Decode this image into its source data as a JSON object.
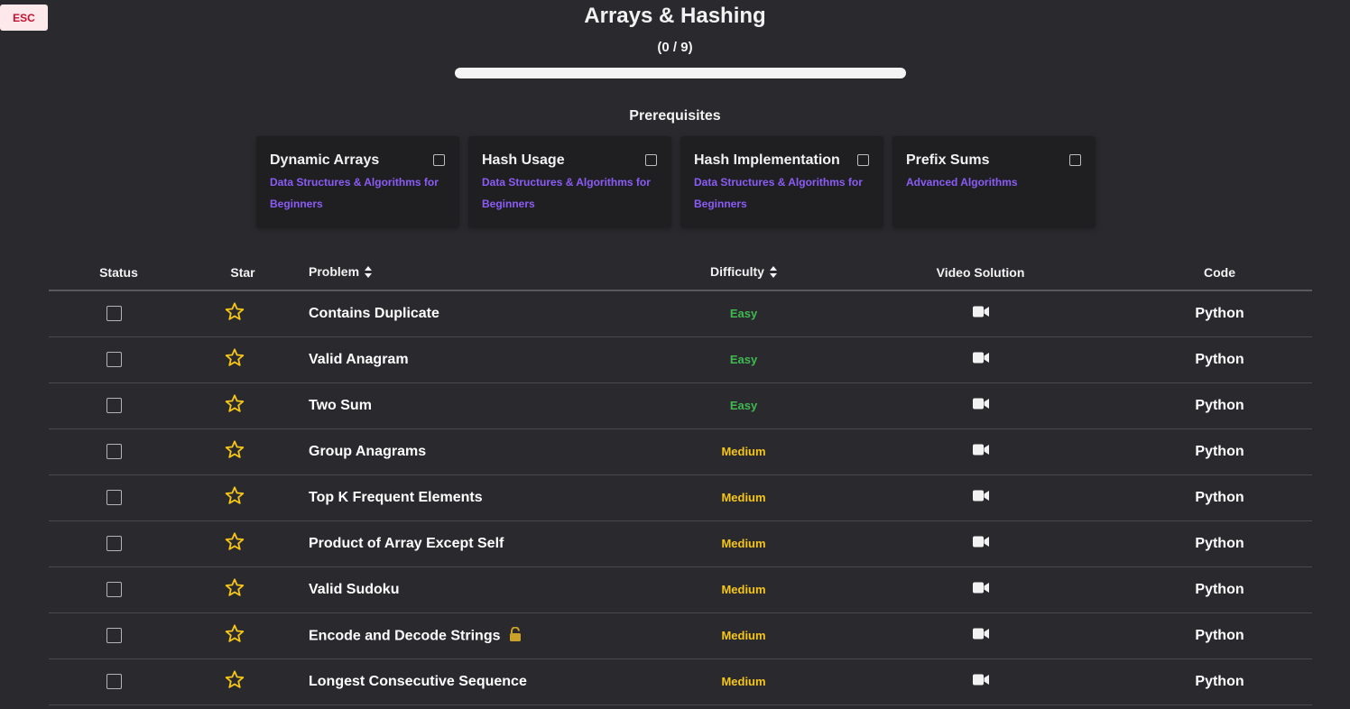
{
  "esc_label": "ESC",
  "title": "Arrays & Hashing",
  "progress": {
    "text": "(0 / 9)",
    "completed": 0,
    "total": 9
  },
  "prerequisites": {
    "heading": "Prerequisites",
    "items": [
      {
        "name": "Dynamic Arrays",
        "course": "Data Structures & Algorithms for Beginners"
      },
      {
        "name": "Hash Usage",
        "course": "Data Structures & Algorithms for Beginners"
      },
      {
        "name": "Hash Implementation",
        "course": "Data Structures & Algorithms for Beginners"
      },
      {
        "name": "Prefix Sums",
        "course": "Advanced Algorithms"
      }
    ]
  },
  "table": {
    "headers": {
      "status": "Status",
      "star": "Star",
      "problem": "Problem",
      "difficulty": "Difficulty",
      "video": "Video Solution",
      "code": "Code"
    },
    "rows": [
      {
        "problem": "Contains Duplicate",
        "difficulty": "Easy",
        "code": "Python",
        "locked": false
      },
      {
        "problem": "Valid Anagram",
        "difficulty": "Easy",
        "code": "Python",
        "locked": false
      },
      {
        "problem": "Two Sum",
        "difficulty": "Easy",
        "code": "Python",
        "locked": false
      },
      {
        "problem": "Group Anagrams",
        "difficulty": "Medium",
        "code": "Python",
        "locked": false
      },
      {
        "problem": "Top K Frequent Elements",
        "difficulty": "Medium",
        "code": "Python",
        "locked": false
      },
      {
        "problem": "Product of Array Except Self",
        "difficulty": "Medium",
        "code": "Python",
        "locked": false
      },
      {
        "problem": "Valid Sudoku",
        "difficulty": "Medium",
        "code": "Python",
        "locked": false
      },
      {
        "problem": "Encode and Decode Strings",
        "difficulty": "Medium",
        "code": "Python",
        "locked": true
      },
      {
        "problem": "Longest Consecutive Sequence",
        "difficulty": "Medium",
        "code": "Python",
        "locked": false
      }
    ]
  },
  "colors": {
    "easy": "#3fb950",
    "medium": "#f5c518",
    "star": "#f5c518",
    "course_link": "#8b5cf6",
    "lock": "#c9a227"
  },
  "icons": {
    "star": "star-outline-icon",
    "video": "video-camera-icon",
    "lock": "unlock-icon",
    "sort": "sort-icon"
  }
}
